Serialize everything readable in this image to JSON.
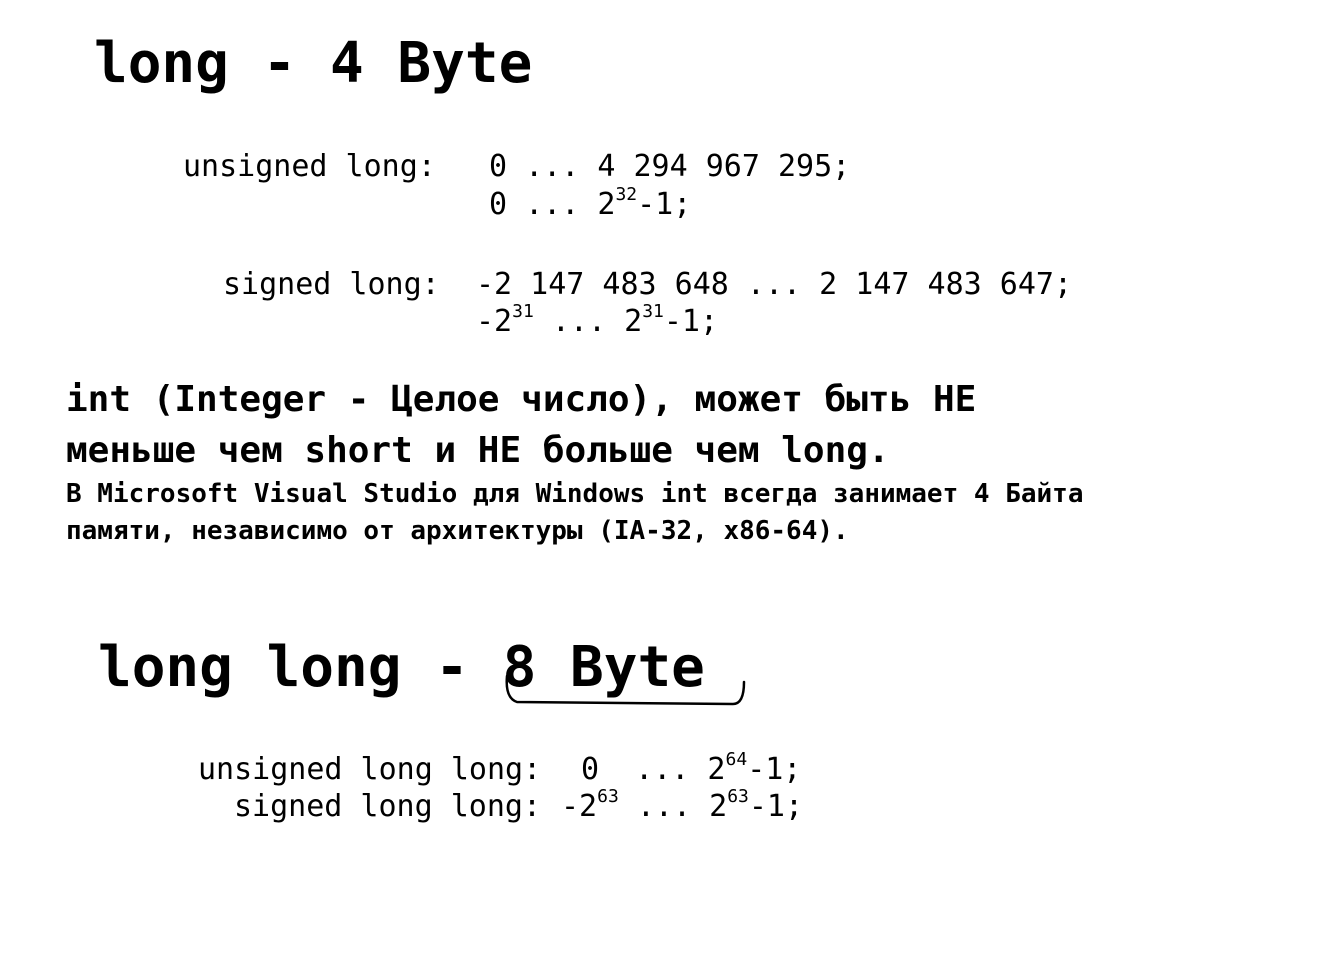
{
  "section_long": {
    "title": "long - 4 Byte",
    "unsigned_label": "unsigned long:",
    "unsigned_range": "0 ... 4 294 967 295;",
    "unsigned_pow_prefix": "0 ... 2",
    "unsigned_pow_exp": "32",
    "unsigned_pow_suffix": "-1;",
    "signed_label": "signed long:",
    "signed_range": "-2 147 483 648 ... 2 147 483 647;",
    "signed_pow_a": "-2",
    "signed_pow_a_exp": "31",
    "signed_pow_mid": " ... 2",
    "signed_pow_b_exp": "31",
    "signed_pow_suffix": "-1;"
  },
  "int_note": {
    "line1": "int (Integer - Целое число), может быть НЕ",
    "line2": "меньше чем short и НЕ больше чем long.",
    "line3": "В Microsoft Visual Studio для Windows int всегда занимает 4 Байта",
    "line4": "памяти, независимо от архитектуры (IA-32, x86-64)."
  },
  "section_long_long": {
    "title_prefix": "long long - ",
    "title_highlight": "8 Byte",
    "unsigned_label": "unsigned long long:",
    "unsigned_a": "0  ... 2",
    "unsigned_exp": "64",
    "unsigned_suffix": "-1;",
    "signed_label": "signed long long:",
    "signed_a": "-2",
    "signed_a_exp": "63",
    "signed_mid": " ... 2",
    "signed_b_exp": "63",
    "signed_suffix": "-1;"
  }
}
